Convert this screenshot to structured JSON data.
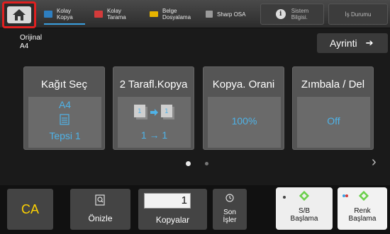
{
  "tabs": [
    {
      "label_line1": "Kolay",
      "label_line2": "Kopya",
      "icon": "copy-icon",
      "color": "#2e7fc1"
    },
    {
      "label_line1": "Kolay",
      "label_line2": "Tarama",
      "icon": "scan-icon",
      "color": "#d33b3b"
    },
    {
      "label_line1": "Belge",
      "label_line2": "Dosyalama",
      "icon": "folder-icon",
      "color": "#e6b400"
    },
    {
      "label_line1": "Sharp OSA",
      "label_line2": "",
      "icon": "osa-icon",
      "color": "#9a9a9a"
    }
  ],
  "system_info": {
    "line1": "Sistem",
    "line2": "Bilgisi."
  },
  "job_status": "İş Durumu",
  "original": {
    "label": "Orijinal",
    "value": "A4"
  },
  "detail_button": "Ayrinti",
  "cards": {
    "paper": {
      "title": "Kağıt Seç",
      "size": "A4",
      "tray": "Tepsi 1"
    },
    "duplex": {
      "title": "2 Tarafl.Kopya",
      "mode": "1 → 1"
    },
    "ratio": {
      "title": "Kopya. Orani",
      "value": "100%"
    },
    "staple": {
      "title": "Zımbala / Del",
      "value": "Off"
    }
  },
  "pager": {
    "pages": 2,
    "current": 1
  },
  "bottom": {
    "ca": "CA",
    "preview": "Önizle",
    "copies_label": "Kopyalar",
    "copies_value": "1",
    "last_jobs_line1": "Son",
    "last_jobs_line2": "İşler",
    "bw_start_line1": "S/B",
    "bw_start_line2": "Başlama",
    "color_start_line1": "Renk",
    "color_start_line2": "Başlama"
  },
  "colors": {
    "accent_blue": "#4fb3e8",
    "ca_yellow": "#ffd200",
    "highlight_red": "#e02020",
    "start_green": "#6ad04a"
  }
}
